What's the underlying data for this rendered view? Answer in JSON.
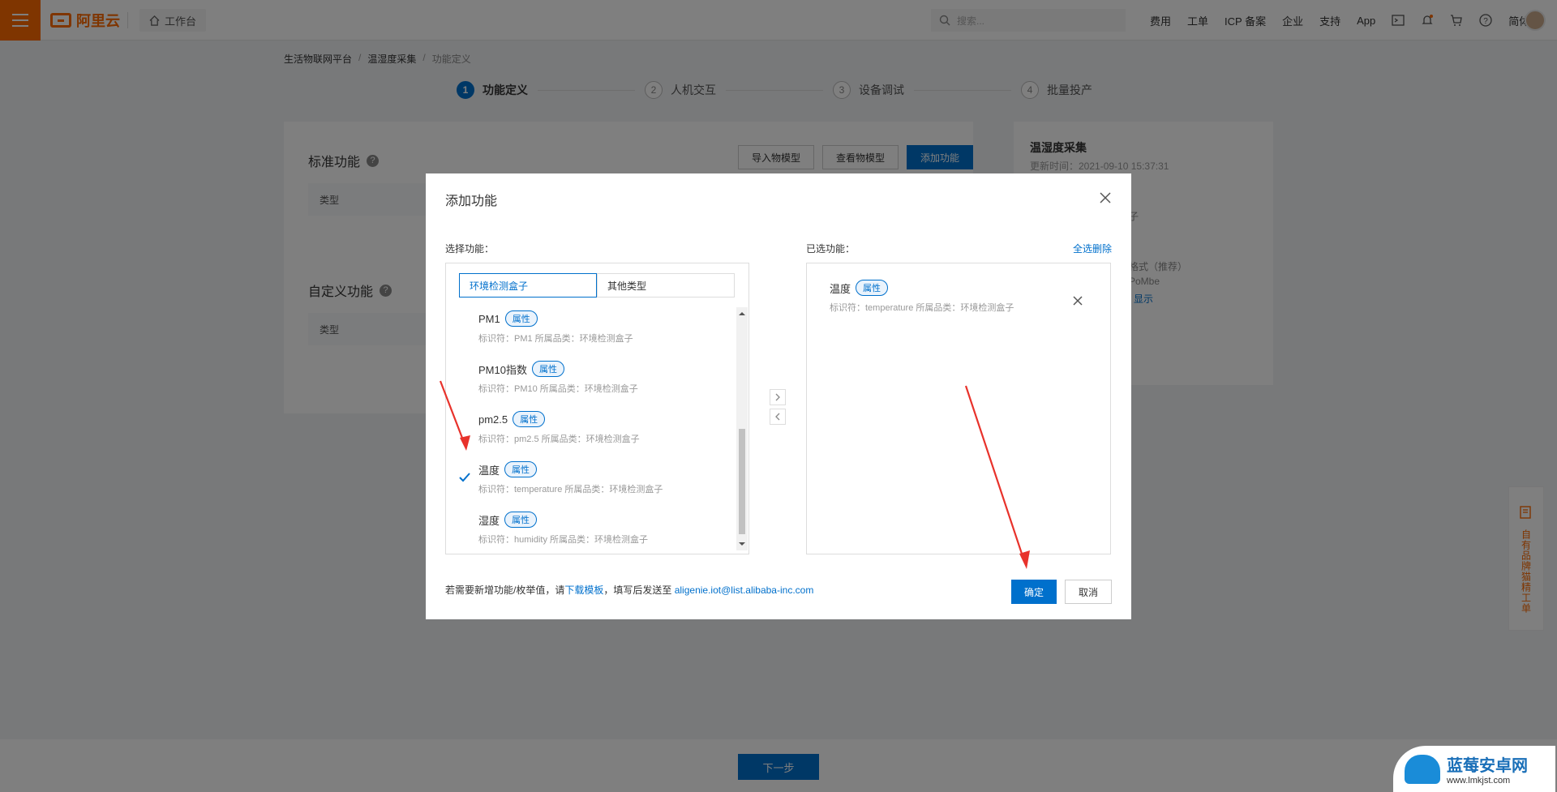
{
  "topbar": {
    "logo_text": "阿里云",
    "workbench": "工作台",
    "search_placeholder": "搜索...",
    "links": [
      "费用",
      "工单",
      "ICP 备案",
      "企业",
      "支持",
      "App"
    ],
    "lang": "简体",
    "brand_color": "#ff6a00"
  },
  "breadcrumb": [
    "生活物联网平台",
    "温湿度采集",
    "功能定义"
  ],
  "steps": [
    {
      "num": "1",
      "label": "功能定义",
      "active": true
    },
    {
      "num": "2",
      "label": "人机交互"
    },
    {
      "num": "3",
      "label": "设备调试"
    },
    {
      "num": "4",
      "label": "批量投产"
    }
  ],
  "left_panel": {
    "standard_title": "标准功能",
    "custom_title": "自定义功能",
    "type_header": "类型",
    "buttons": [
      "导入物模型",
      "查看物模型",
      "添加功能"
    ]
  },
  "right_panel": {
    "title": "温湿度采集",
    "update_time": "更新时间：2021-09-10 15:37:31",
    "frag1": "子",
    "frag2": "格式（推荐）",
    "frag3": "PoMbe",
    "frag4": "显示"
  },
  "modal": {
    "title": "添加功能",
    "select_label": "选择功能：",
    "selected_label": "已选功能：",
    "clear_all": "全选删除",
    "tabs": [
      "环境检测盒子",
      "其他类型"
    ],
    "items": [
      {
        "name": "PM1",
        "tag": "属性",
        "meta": "标识符：PM1   所属品类：环境检测盒子",
        "checked": false
      },
      {
        "name": "PM10指数",
        "tag": "属性",
        "meta": "标识符：PM10   所属品类：环境检测盒子",
        "checked": false
      },
      {
        "name": "pm2.5",
        "tag": "属性",
        "meta": "标识符：pm2.5   所属品类：环境检测盒子",
        "checked": false
      },
      {
        "name": "温度",
        "tag": "属性",
        "meta": "标识符：temperature   所属品类：环境检测盒子",
        "checked": true
      },
      {
        "name": "湿度",
        "tag": "属性",
        "meta": "标识符：humidity   所属品类：环境检测盒子",
        "checked": false
      }
    ],
    "selected": {
      "name": "温度",
      "tag": "属性",
      "meta": "标识符：temperature   所属品类：环境检测盒子"
    },
    "footer_prefix": "若需要新增功能/枚举值，请",
    "footer_link": "下载模板",
    "footer_mid": "，填写后发送至",
    "footer_email": "aligenie.iot@list.alibaba-inc.com",
    "ok": "确定",
    "cancel": "取消"
  },
  "bottom": {
    "next": "下一步"
  },
  "side_feedback": "自有品牌猫精工单",
  "watermark": {
    "title": "蓝莓安卓网",
    "url": "www.lmkjst.com"
  }
}
